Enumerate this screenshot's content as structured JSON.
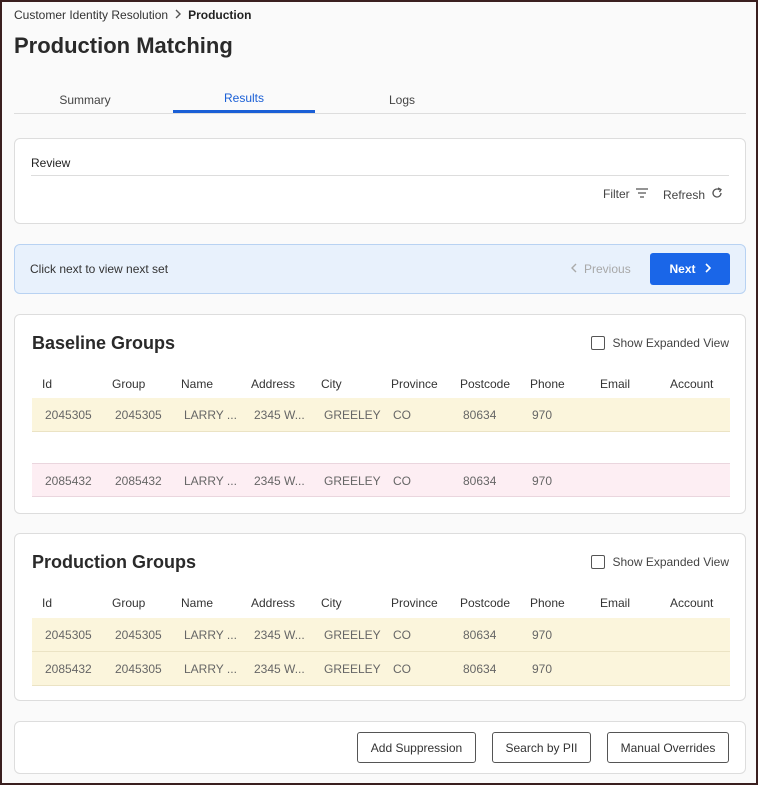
{
  "breadcrumb": {
    "parent": "Customer Identity Resolution",
    "current": "Production"
  },
  "page_title": "Production Matching",
  "tabs": [
    {
      "label": "Summary",
      "active": false
    },
    {
      "label": "Results",
      "active": true
    },
    {
      "label": "Logs",
      "active": false
    }
  ],
  "review": {
    "title": "Review",
    "filter_label": "Filter",
    "refresh_label": "Refresh"
  },
  "pager": {
    "message": "Click next to view next set",
    "previous_label": "Previous",
    "next_label": "Next"
  },
  "columns": [
    "Id",
    "Group",
    "Name",
    "Address",
    "City",
    "Province",
    "Postcode",
    "Phone",
    "Email",
    "Account"
  ],
  "baseline": {
    "title": "Baseline Groups",
    "expanded_label": "Show Expanded View",
    "rows": [
      [
        "2045305",
        "2045305",
        "LARRY ...",
        "2345 W...",
        "GREELEY",
        "CO",
        "80634",
        "970",
        "",
        ""
      ],
      [
        "",
        "",
        "",
        "",
        "",
        "",
        "",
        "",
        "",
        ""
      ],
      [
        "2085432",
        "2085432",
        "LARRY ...",
        "2345 W...",
        "GREELEY",
        "CO",
        "80634",
        "970",
        "",
        ""
      ]
    ]
  },
  "production": {
    "title": "Production Groups",
    "expanded_label": "Show Expanded View",
    "rows": [
      [
        "2045305",
        "2045305",
        "LARRY ...",
        "2345 W...",
        "GREELEY",
        "CO",
        "80634",
        "970",
        "",
        ""
      ],
      [
        "2085432",
        "2045305",
        "LARRY ...",
        "2345 W...",
        "GREELEY",
        "CO",
        "80634",
        "970",
        "",
        ""
      ]
    ]
  },
  "actions": {
    "add_suppression": "Add Suppression",
    "search_by_pii": "Search by PII",
    "manual_overrides": "Manual Overrides"
  },
  "colors": {
    "accent": "#1a66e8",
    "row_yellow": "#fbf5dc",
    "row_pink": "#fdeef3",
    "info_bg": "#e8f1fc"
  },
  "icons": {
    "breadcrumb_separator": "chevron-right-icon",
    "filter": "filter-lines-icon",
    "refresh": "refresh-icon",
    "previous": "chevron-left-icon",
    "next": "chevron-right-icon"
  }
}
